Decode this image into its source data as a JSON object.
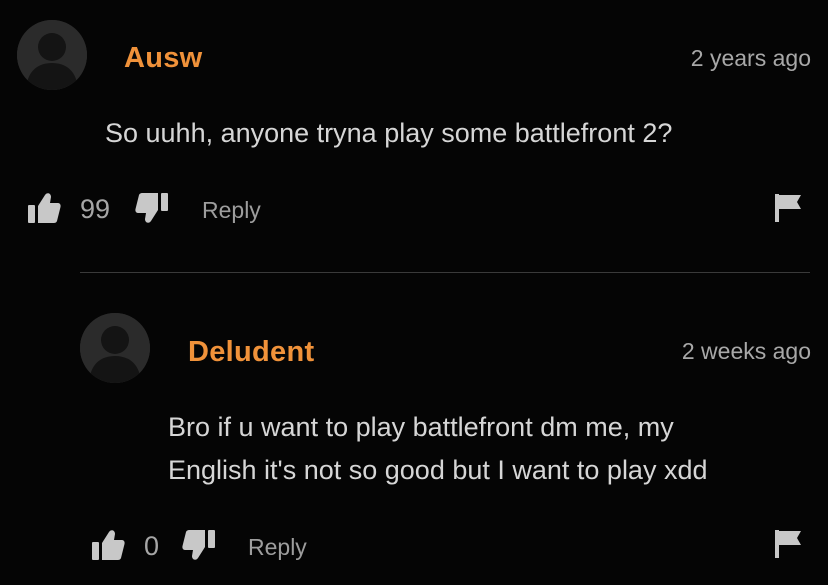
{
  "comments": [
    {
      "username": "Ausw",
      "timestamp": "2 years ago",
      "text": "So uuhh, anyone tryna play some battlefront 2?",
      "likes": "99",
      "reply_label": "Reply"
    },
    {
      "username": "Deludent",
      "timestamp": "2 weeks ago",
      "text_lines": [
        "Bro if u want to play battlefront dm me, my",
        "English it's not so good but I want to play xdd"
      ],
      "likes": "0",
      "reply_label": "Reply"
    }
  ],
  "colors": {
    "background": "#050505",
    "username": "#f0923a",
    "text": "#d6d6d6",
    "muted": "#a8a8a8",
    "icon": "#c8c8c8",
    "avatar_bg": "#2b2b2b"
  },
  "icons": [
    "user-avatar-icon",
    "thumbs-up-icon",
    "thumbs-down-icon",
    "flag-icon"
  ]
}
